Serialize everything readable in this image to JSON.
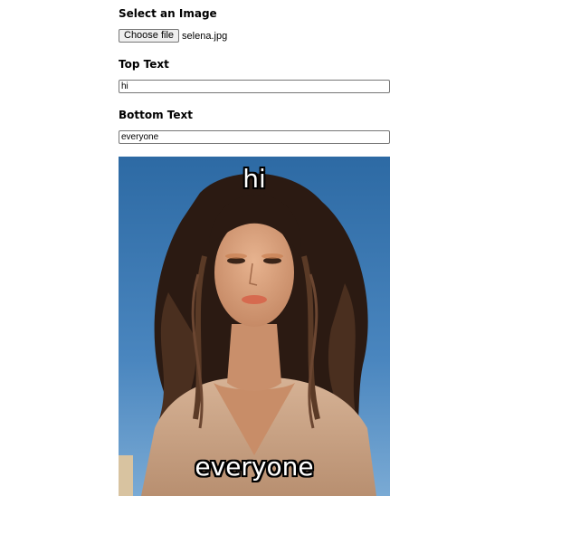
{
  "form": {
    "select_label": "Select an Image",
    "choose_file_button": "Choose file",
    "file_name": "selena.jpg",
    "top_label": "Top Text",
    "top_value": "hi",
    "bottom_label": "Bottom Text",
    "bottom_value": "everyone"
  },
  "meme": {
    "top_text": "hi",
    "bottom_text": "everyone",
    "alt": "Photo of a woman with long wavy dark hair against a blue sky"
  },
  "colors": {
    "sky": "#3f7bb5",
    "hair": "#2a1a12",
    "skin": "#d9a07c",
    "sweater": "#caa586",
    "meme_text": "#ffffff",
    "meme_outline": "#000000"
  }
}
